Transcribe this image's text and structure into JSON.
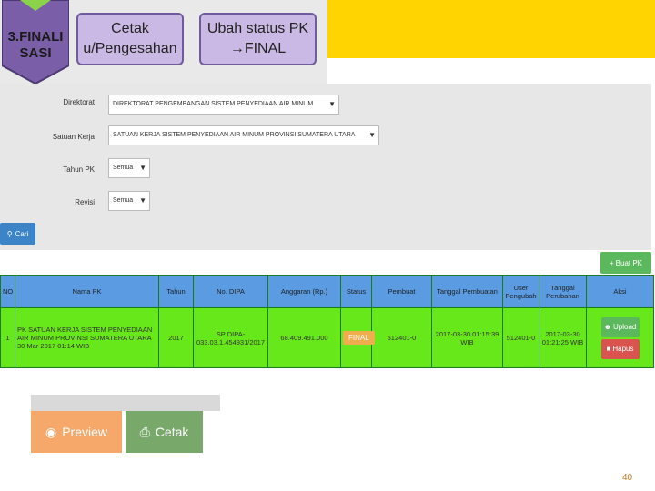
{
  "header": {
    "step_label": "3.FINALI SASI",
    "steps": [
      {
        "label": "Cetak u/Pengesahan"
      },
      {
        "label": "Ubah status PK →FINAL"
      }
    ],
    "colors": {
      "shield": "#7a5fa8",
      "step_box": "#c9b9e4",
      "yellow": "#ffd400"
    }
  },
  "filters": {
    "direktorat": {
      "label": "Direktorat",
      "value": "DIREKTORAT PENGEMBANGAN SISTEM PENYEDIAAN AIR MINUM"
    },
    "satuan_kerja": {
      "label": "Satuan Kerja",
      "value": "SATUAN KERJA SISTEM PENYEDIAAN AIR MINUM PROVINSI SUMATERA UTARA"
    },
    "tahun_pk": {
      "label": "Tahun PK",
      "value": "Semua"
    },
    "revisi": {
      "label": "Revisi",
      "value": "Semua"
    },
    "cari_label": "Cari"
  },
  "toolbar": {
    "buat_pk_label": "Buat PK"
  },
  "table": {
    "columns": [
      "NO",
      "Nama PK",
      "Tahun",
      "No. DIPA",
      "Anggaran (Rp.)",
      "Status",
      "Pembuat",
      "Tanggal Pembuatan",
      "User Pengubah",
      "Tanggal Perubahan",
      "Aksi"
    ],
    "rows": [
      {
        "no": "1",
        "nama_pk": "PK SATUAN KERJA SISTEM PENYEDIAAN AIR MINUM PROVINSI SUMATERA UTARA 30 Mar 2017 01:14 WIB",
        "tahun": "2017",
        "no_dipa": "SP DIPA-033.03.1.454931/2017",
        "anggaran": "68.409.491.000",
        "status": "FINAL",
        "pembuat": "512401-0",
        "tanggal_pembuatan": "2017-03-30 01:15:39 WIB",
        "user_pengubah": "512401-0",
        "tanggal_perubahan": "2017-03-30 01:21:25 WIB",
        "aksi": {
          "upload": "Upload",
          "hapus": "Hapus"
        }
      }
    ]
  },
  "bottom": {
    "preview_label": "Preview",
    "cetak_label": "Cetak"
  },
  "page_number": "40"
}
